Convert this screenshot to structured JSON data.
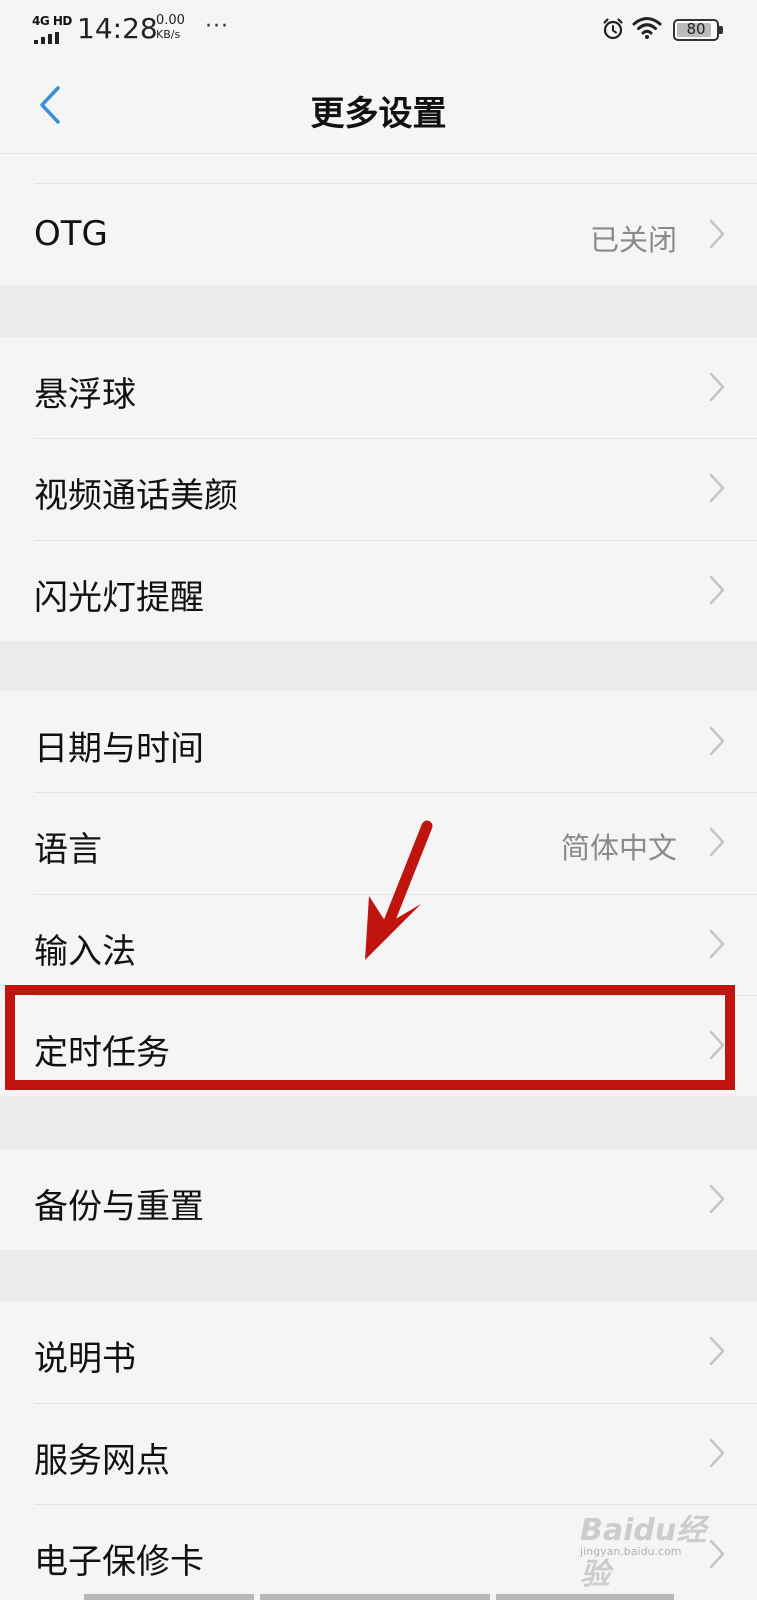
{
  "status_bar": {
    "network": "4G HD",
    "time": "14:28",
    "speed_value": "0.00",
    "speed_unit": "KB/s",
    "more": "···",
    "battery_level": "80"
  },
  "header": {
    "title": "更多设置"
  },
  "groups": [
    {
      "rows": [
        {
          "label": "OTG",
          "value": "已关闭"
        }
      ]
    },
    {
      "rows": [
        {
          "label": "悬浮球",
          "value": ""
        },
        {
          "label": "视频通话美颜",
          "value": ""
        },
        {
          "label": "闪光灯提醒",
          "value": ""
        }
      ]
    },
    {
      "rows": [
        {
          "label": "日期与时间",
          "value": ""
        },
        {
          "label": "语言",
          "value": "简体中文"
        },
        {
          "label": "输入法",
          "value": ""
        },
        {
          "label": "定时任务",
          "value": ""
        }
      ]
    },
    {
      "rows": [
        {
          "label": "备份与重置",
          "value": ""
        }
      ]
    },
    {
      "rows": [
        {
          "label": "说明书",
          "value": ""
        },
        {
          "label": "服务网点",
          "value": ""
        },
        {
          "label": "电子保修卡",
          "value": ""
        }
      ]
    }
  ],
  "watermark": {
    "brand": "Baidu经验",
    "url": "jingyan.baidu.com"
  },
  "colors": {
    "accent": "#3b8fd8",
    "highlight": "#c0150f",
    "background": "#f5f5f5",
    "group_gap": "#ebebeb",
    "secondary_text": "#8a8a8a"
  }
}
